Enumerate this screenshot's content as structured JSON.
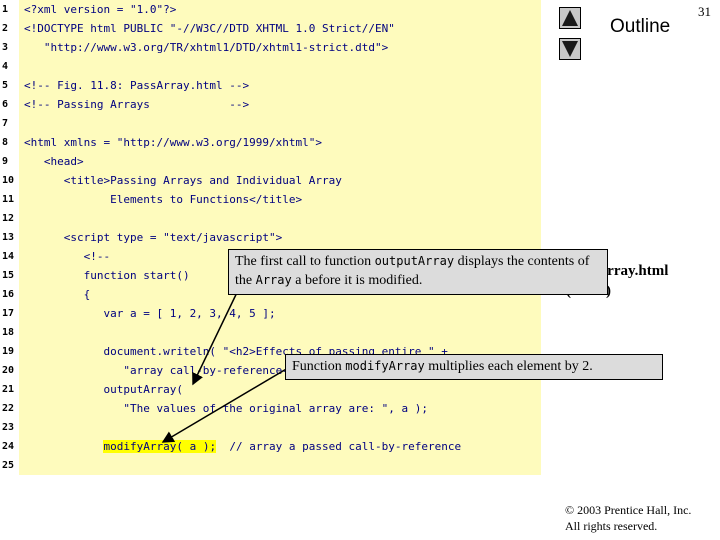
{
  "slide_number": "31",
  "sidebar": {
    "outline_label": "Outline",
    "nav_up_icon": "triangle-up-icon",
    "nav_down_icon": "triangle-down-icon",
    "file_title": "PassArray.html",
    "page_info": "(1 of 3)"
  },
  "code_lines": [
    {
      "num": "1",
      "text": "<?xml version = \"1.0\"?>"
    },
    {
      "num": "2",
      "text": "<!DOCTYPE html PUBLIC \"-//W3C//DTD XHTML 1.0 Strict//EN\""
    },
    {
      "num": "3",
      "text": "   \"http://www.w3.org/TR/xhtml1/DTD/xhtml1-strict.dtd\">"
    },
    {
      "num": "4",
      "text": ""
    },
    {
      "num": "5",
      "text": "<!-- Fig. 11.8: PassArray.html -->"
    },
    {
      "num": "6",
      "text": "<!-- Passing Arrays            -->"
    },
    {
      "num": "7",
      "text": ""
    },
    {
      "num": "8",
      "text": "<html xmlns = \"http://www.w3.org/1999/xhtml\">"
    },
    {
      "num": "9",
      "text": "   <head>"
    },
    {
      "num": "10",
      "text": "      <title>Passing Arrays and Individual Array"
    },
    {
      "num": "11",
      "text": "             Elements to Functions</title>"
    },
    {
      "num": "12",
      "text": ""
    },
    {
      "num": "13",
      "text": "      <script type = \"text/javascript\">"
    },
    {
      "num": "14",
      "text": "         <!--"
    },
    {
      "num": "15",
      "text": "         function start()"
    },
    {
      "num": "16",
      "text": "         {"
    },
    {
      "num": "17",
      "text": "            var a = [ 1, 2, 3, 4, 5 ];"
    },
    {
      "num": "18",
      "text": ""
    },
    {
      "num": "19",
      "text": "            document.writeln( \"<h2>Effects of passing entire \" +"
    },
    {
      "num": "20",
      "text": "               \"array call-by-reference</h2>\" );"
    },
    {
      "num": "21",
      "text": "            outputArray("
    },
    {
      "num": "22",
      "text": "               \"The values of the original array are: \", a );"
    },
    {
      "num": "23",
      "text": ""
    },
    {
      "num": "24",
      "text": "            modifyArray( a );  // array a passed call-by-reference",
      "highlight": "modifyArray( a );"
    },
    {
      "num": "25",
      "text": ""
    }
  ],
  "callouts": [
    {
      "html": "The first call to function <span class=\"mono\">outputArray</span> displays the contents of the <span class=\"mono\">Array</span> a before it is modified."
    },
    {
      "html": "Function <span class=\"mono\">modifyArray</span> multiplies each element by 2."
    }
  ],
  "callout_text": {
    "c1_a": "The first call to function ",
    "c1_b": "outputArray",
    "c1_c": " displays the contents of the ",
    "c1_d": "Array",
    "c1_e": " a before it is modified.",
    "c2_a": "Function ",
    "c2_b": "modifyArray",
    "c2_c": " multiplies each element by 2."
  },
  "copyright": {
    "line1": "© 2003 Prentice Hall, Inc.",
    "line2": "All rights reserved."
  }
}
